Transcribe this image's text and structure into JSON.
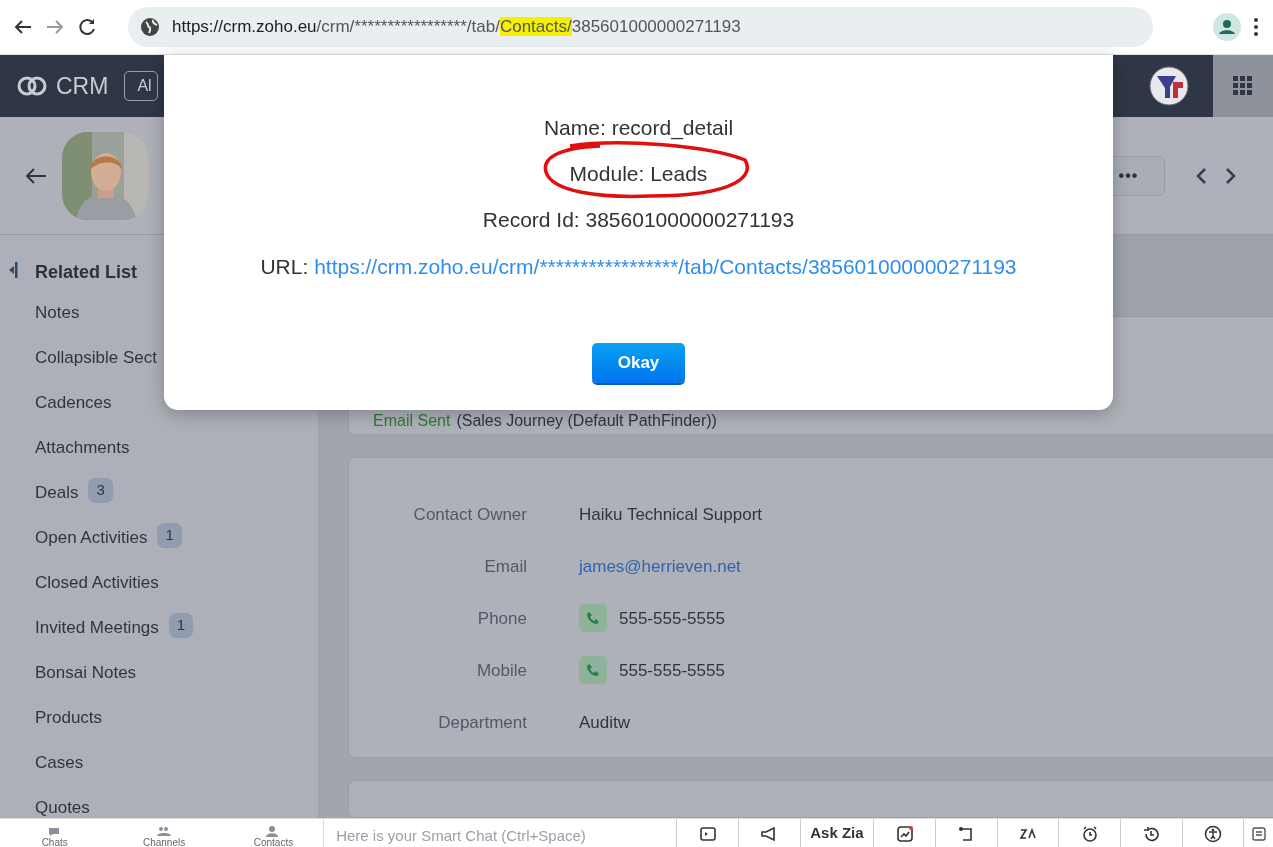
{
  "browser": {
    "url_parts": [
      {
        "text": "https://crm.zoho.eu",
        "highlighted": false
      },
      {
        "text": "/crm/*****************/tab/",
        "highlighted": false
      },
      {
        "text": "Contacts/",
        "highlighted": true
      },
      {
        "text": "385601000000271193",
        "highlighted": false
      }
    ]
  },
  "app_header": {
    "logo": "CRM",
    "button": "Al"
  },
  "record_header": {
    "more": "•••"
  },
  "sidebar": {
    "title": "Related List",
    "items": [
      {
        "label": "Notes"
      },
      {
        "label": "Collapsible Sect"
      },
      {
        "label": "Cadences"
      },
      {
        "label": "Attachments"
      },
      {
        "label": "Deals",
        "count": "3"
      },
      {
        "label": "Open Activities",
        "count": "1"
      },
      {
        "label": "Closed Activities"
      },
      {
        "label": "Invited Meetings",
        "count": "1"
      },
      {
        "label": "Bonsai Notes"
      },
      {
        "label": "Products"
      },
      {
        "label": "Cases"
      },
      {
        "label": "Quotes"
      }
    ]
  },
  "timeline": {
    "status": "Email Sent",
    "detail": "(Sales Journey (Default PathFinder))"
  },
  "details": [
    {
      "label": "Contact Owner",
      "value": "Haiku Technical Support",
      "kind": "text"
    },
    {
      "label": "Email",
      "value": "james@herrieven.net",
      "kind": "link"
    },
    {
      "label": "Phone",
      "value": "555-555-5555",
      "kind": "phone"
    },
    {
      "label": "Mobile",
      "value": "555-555-5555",
      "kind": "phone"
    },
    {
      "label": "Department",
      "value": "Auditw",
      "kind": "text"
    }
  ],
  "modal": {
    "lines": [
      {
        "text": "Name: record_detail",
        "circled": false
      },
      {
        "text": "Module: Leads",
        "circled": true
      },
      {
        "text": "Record Id: 385601000000271193",
        "circled": false
      }
    ],
    "url_label": "URL:",
    "url": "https://crm.zoho.eu/crm/*****************/tab/Contacts/385601000000271193",
    "button": "Okay"
  },
  "bottom_bar": {
    "tabs": [
      "Chats",
      "Channels",
      "Contacts"
    ],
    "chat_placeholder": "Here is your Smart Chat (Ctrl+Space)",
    "ask_zia": "Ask Zia"
  }
}
